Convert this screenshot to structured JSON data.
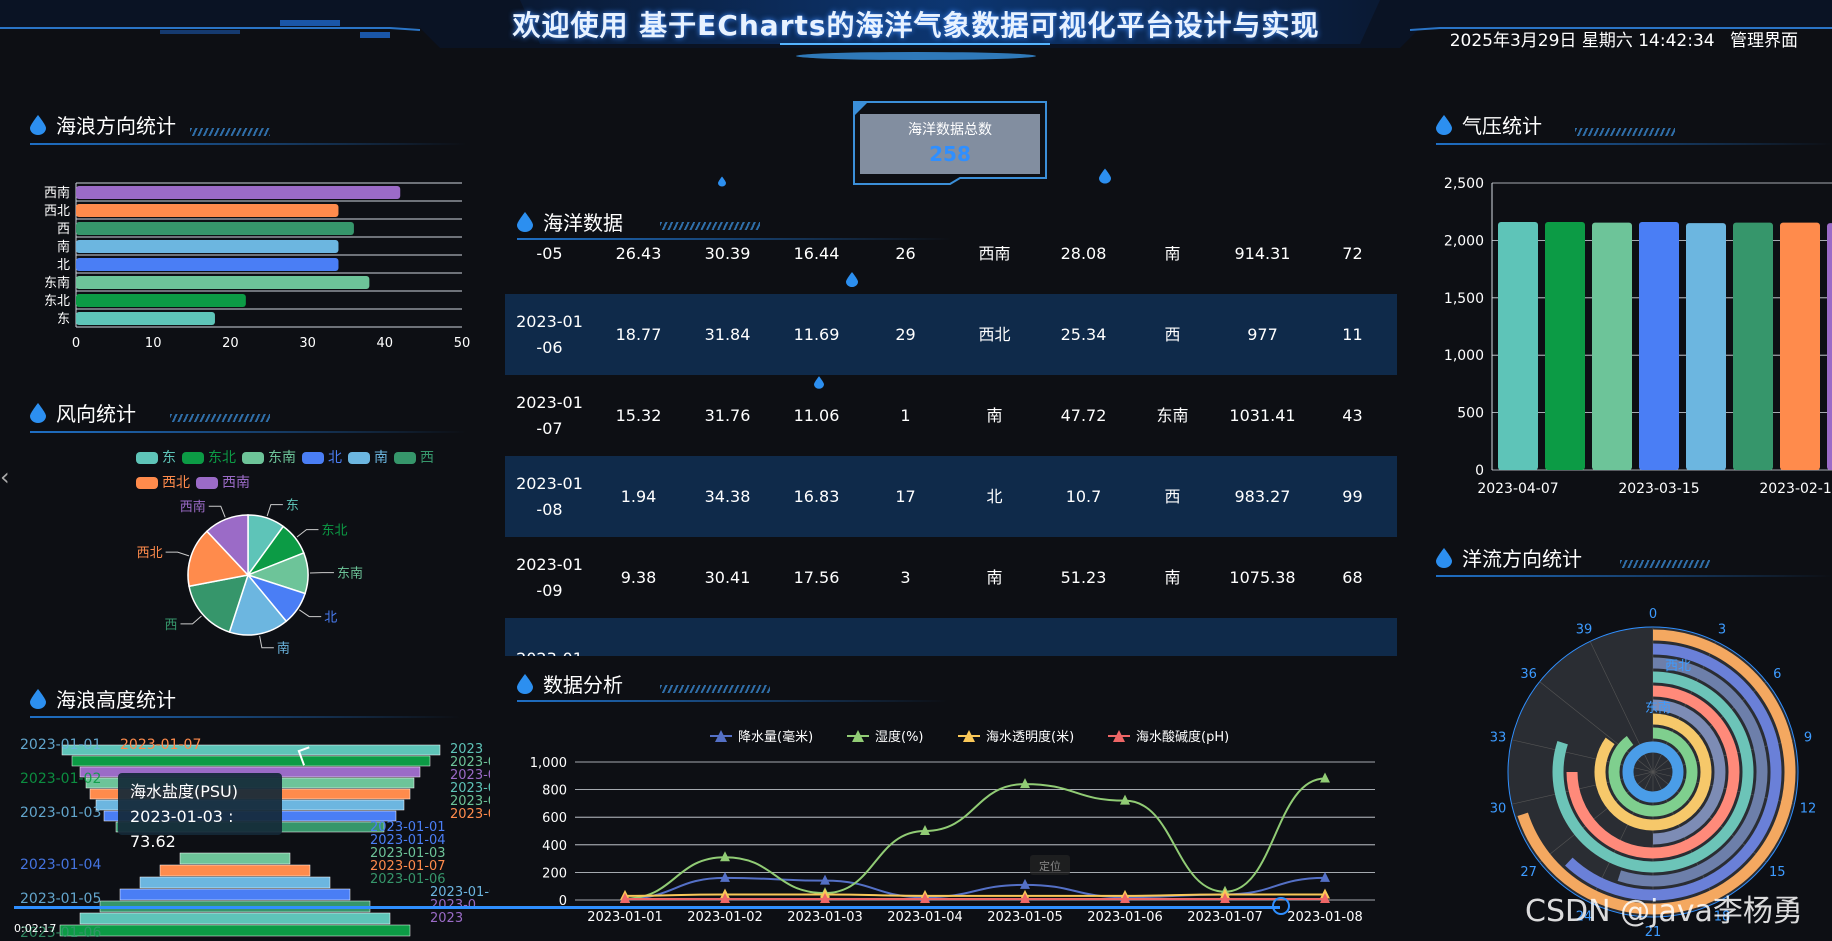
{
  "header": {
    "title": "欢迎使用 基于ECharts的海洋气象数据可视化平台设计与实现",
    "datetime": "2025年3月29日 星期六 14:42:34",
    "admin_link": "管理界面"
  },
  "panels": {
    "wave_dir": "海浪方向统计",
    "wind_dir": "风向统计",
    "wave_height": "海浪高度统计",
    "ocean_data": "海洋数据",
    "analysis": "数据分析",
    "pressure": "气压统计",
    "current_dir": "洋流方向统计"
  },
  "total": {
    "label": "海洋数据总数",
    "value": "258"
  },
  "colors": {
    "teal": "#5ec4b8",
    "green": "#0c9b45",
    "lightgreen": "#6dc499",
    "blue": "#4a7ef5",
    "skyblue": "#6cb6e0",
    "darkgreen": "#36966b",
    "orange": "#ff8b4c",
    "purple": "#9b6bc7"
  },
  "wave_dir_chart": {
    "type": "bar",
    "categories": [
      "东",
      "东北",
      "东南",
      "北",
      "南",
      "西",
      "西北",
      "西南"
    ],
    "values": [
      18,
      22,
      38,
      34,
      34,
      36,
      34,
      42
    ],
    "xlim": [
      0,
      50
    ],
    "xticks": [
      "0",
      "10",
      "20",
      "30",
      "40",
      "50"
    ],
    "colors": [
      "#5ec4b8",
      "#0c9b45",
      "#6dc499",
      "#4a7ef5",
      "#6cb6e0",
      "#36966b",
      "#ff8b4c",
      "#9b6bc7"
    ]
  },
  "wind_dir_chart": {
    "type": "pie",
    "legend": [
      "东",
      "东北",
      "东南",
      "北",
      "南",
      "西",
      "西北",
      "西南"
    ],
    "labels": [
      "东",
      "东北",
      "东南",
      "北",
      "南",
      "西",
      "西北",
      "西南"
    ],
    "values": [
      10,
      9,
      11,
      9,
      16,
      17,
      16,
      12
    ],
    "colors": [
      "#5ec4b8",
      "#0c9b45",
      "#6dc499",
      "#4a7ef5",
      "#6cb6e0",
      "#36966b",
      "#ff8b4c",
      "#9b6bc7"
    ]
  },
  "wave_height": {
    "left_labels": [
      "2023-01-01",
      "2023-01-02",
      "2023-01-03",
      "2023-01-04",
      "2023-01-05",
      "2023-01-06"
    ],
    "top_label": "2023-01-07",
    "tooltip_title": "海水盐度(PSU)",
    "tooltip_value": "2023-01-03 : 73.62",
    "right_labels": [
      "2023",
      "2023-0",
      "2023-01",
      "2023-01",
      "2023-01",
      "2023-01-05",
      "2023-01-01",
      "2023-01-04",
      "2023-01-03",
      "2023-01-07",
      "2023-01-06",
      "2023-01-0",
      "2023-0",
      "2023"
    ]
  },
  "table": {
    "rows": [
      {
        "date": [
          "",
          "-05"
        ],
        "vals": [
          "26.43",
          "30.39",
          "16.44",
          "26",
          "西南",
          "28.08",
          "南",
          "914.31",
          "72"
        ]
      },
      {
        "date": [
          "2023-01",
          "-06"
        ],
        "vals": [
          "18.77",
          "31.84",
          "11.69",
          "29",
          "西北",
          "25.34",
          "西",
          "977",
          "11"
        ]
      },
      {
        "date": [
          "2023-01",
          "-07"
        ],
        "vals": [
          "15.32",
          "31.76",
          "11.06",
          "1",
          "南",
          "47.72",
          "东南",
          "1031.41",
          "43"
        ]
      },
      {
        "date": [
          "2023-01",
          "-08"
        ],
        "vals": [
          "1.94",
          "34.38",
          "16.83",
          "17",
          "北",
          "10.7",
          "西",
          "983.27",
          "99"
        ]
      },
      {
        "date": [
          "2023-01",
          "-09"
        ],
        "vals": [
          "9.38",
          "30.41",
          "17.56",
          "3",
          "南",
          "51.23",
          "南",
          "1075.38",
          "68"
        ]
      },
      {
        "date": [
          "2023-01",
          ""
        ],
        "vals": [
          "",
          "",
          "",
          "",
          "",
          "",
          "",
          "",
          ""
        ]
      }
    ]
  },
  "analysis_chart": {
    "type": "line",
    "legend": [
      "降水量(毫米)",
      "湿度(%)",
      "海水透明度(米)",
      "海水酸碱度(pH)"
    ],
    "legend_colors": [
      "#5470c6",
      "#91cc75",
      "#fac858",
      "#ee6666"
    ],
    "categories": [
      "2023-01-01",
      "2023-01-02",
      "2023-01-03",
      "2023-01-04",
      "2023-01-05",
      "2023-01-06",
      "2023-01-07",
      "2023-01-08"
    ],
    "yticks": [
      "0",
      "200",
      "400",
      "600",
      "800",
      "1,000"
    ],
    "ylim": [
      0,
      1000
    ],
    "series": [
      {
        "name": "降水量(毫米)",
        "values": [
          10,
          160,
          140,
          20,
          110,
          20,
          40,
          160
        ]
      },
      {
        "name": "湿度(%)",
        "values": [
          10,
          310,
          50,
          500,
          840,
          720,
          60,
          880
        ]
      },
      {
        "name": "海水透明度(米)",
        "values": [
          30,
          40,
          40,
          30,
          30,
          30,
          40,
          40
        ]
      },
      {
        "name": "海水酸碱度(pH)",
        "values": [
          7,
          7,
          7,
          7,
          7,
          7,
          7,
          7
        ]
      }
    ],
    "marker": "定位"
  },
  "pressure_chart": {
    "type": "bar",
    "yticks": [
      "0",
      "500",
      "1,000",
      "1,500",
      "2,000",
      "2,500"
    ],
    "ylim": [
      0,
      2500
    ],
    "xlabels": [
      "2023-04-07",
      "2023-03-15",
      "2023-02-17"
    ],
    "values": [
      2160,
      2160,
      2155,
      2160,
      2150,
      2155,
      2155,
      2150
    ],
    "colors": [
      "#5ec4b8",
      "#0c9b45",
      "#6dc499",
      "#4a7ef5",
      "#6cb6e0",
      "#36966b",
      "#ff8b4c",
      "#9b6bc7"
    ]
  },
  "current_chart": {
    "type": "polar-bar",
    "angle_labels": [
      "0",
      "3",
      "6",
      "9",
      "12",
      "15",
      "18",
      "21",
      "24",
      "27",
      "30",
      "33",
      "36",
      "39"
    ],
    "inner_labels": [
      "西北",
      "东南"
    ]
  },
  "video": {
    "time": "0:02:17"
  },
  "watermark": "CSDN @java李杨勇"
}
